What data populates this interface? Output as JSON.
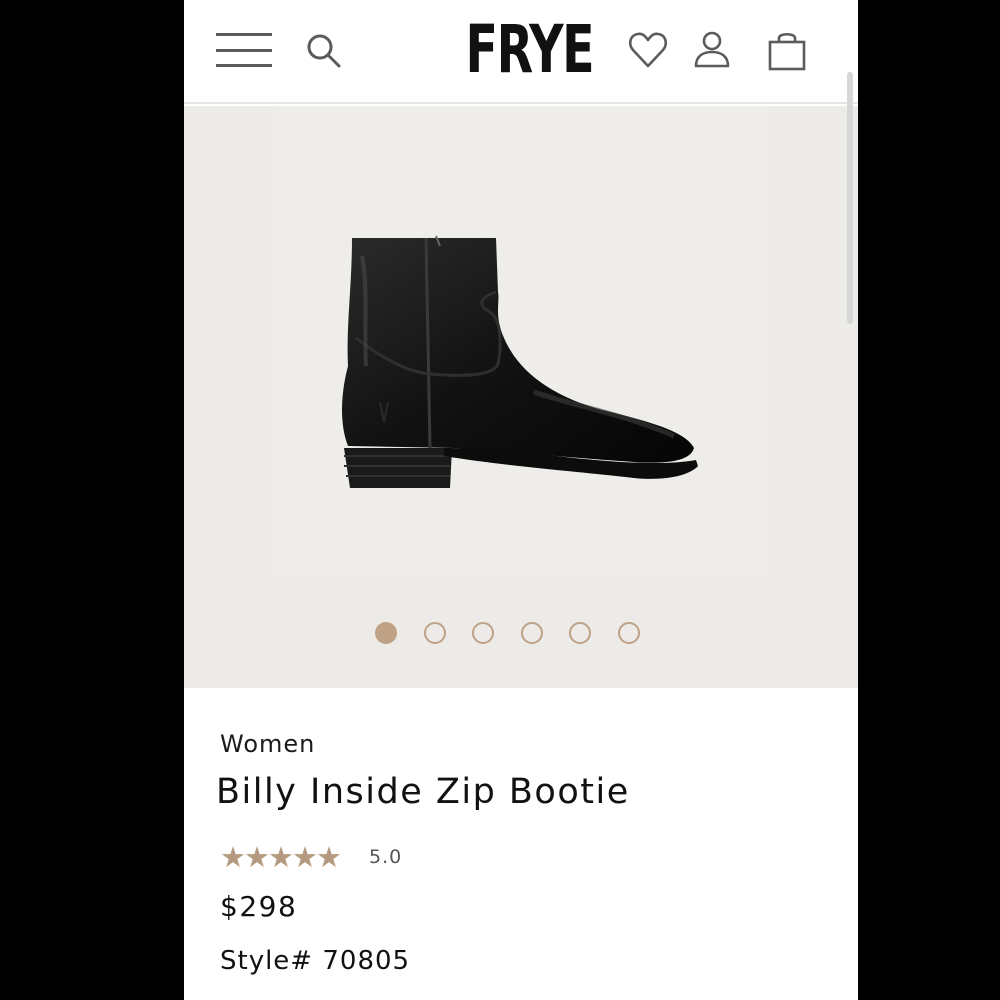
{
  "brand": {
    "logo_text": "FRYE"
  },
  "header": {
    "icons": [
      "menu-icon",
      "search-icon",
      "heart-icon",
      "account-icon",
      "bag-icon"
    ]
  },
  "gallery": {
    "image_count": 6,
    "active_index": 0,
    "accent_color": "#bfa286",
    "background_color": "#edebe7"
  },
  "product": {
    "category": "Women",
    "name": "Billy Inside Zip Bootie",
    "rating": "5.0",
    "rating_stars": 5,
    "price": "$298",
    "style": "Style# 70805"
  }
}
